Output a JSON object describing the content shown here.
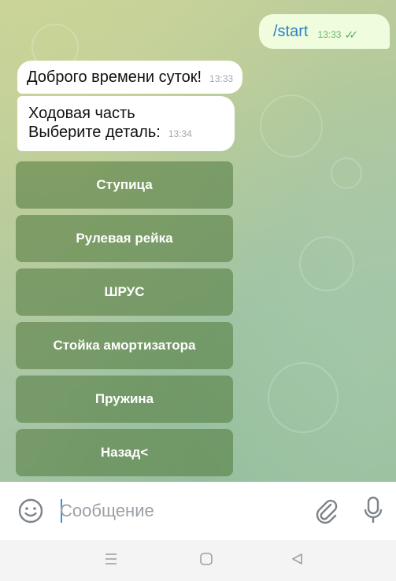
{
  "messages": {
    "outgoing": {
      "text": "/start",
      "time": "13:33",
      "status_icon": "double-check-icon"
    },
    "greeting": {
      "text": "Доброго времени суток!",
      "time": "13:33"
    },
    "prompt": {
      "line1": "Ходовая часть",
      "line2": "Выберите деталь:",
      "time": "13:34"
    }
  },
  "keyboard": {
    "buttons": [
      "Ступица",
      "Рулевая рейка",
      "ШРУС",
      "Стойка амортизатора",
      "Пружина",
      "Назад<"
    ]
  },
  "input": {
    "placeholder": "Сообщение",
    "icons": [
      "emoji-icon",
      "attach-icon",
      "mic-icon"
    ]
  },
  "nav_bar": {
    "icons": [
      "menu-icon",
      "home-icon",
      "back-icon"
    ]
  },
  "colors": {
    "outgoing_bubble": "#effdde",
    "command_text": "#2b7fc2",
    "keyboard_button": "#58804688",
    "wallpaper": "#b4c99c"
  }
}
